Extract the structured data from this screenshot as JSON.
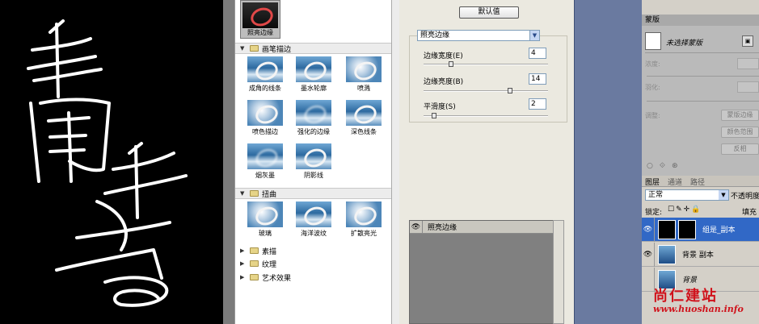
{
  "gallery": {
    "selected": {
      "label": "照亮边缘"
    },
    "categories": [
      {
        "label": "画笔描边",
        "expanded": true
      },
      {
        "label": "扭曲",
        "expanded": true
      },
      {
        "label": "素描",
        "expanded": false
      },
      {
        "label": "纹理",
        "expanded": false
      },
      {
        "label": "艺术效果",
        "expanded": false
      }
    ],
    "brush_filters": [
      "成角的线条",
      "墨水轮廓",
      "喷溅",
      "喷色描边",
      "强化的边缘",
      "深色线条",
      "烟灰墨",
      "阴影线"
    ],
    "distort_filters": [
      "玻璃",
      "海洋波纹",
      "扩散亮光"
    ]
  },
  "settings": {
    "default_button": "默认值",
    "filter_select": "照亮边缘",
    "params": [
      {
        "label": "边缘宽度(E)",
        "value": "4",
        "slider_fraction": 0.21
      },
      {
        "label": "边缘亮度(B)",
        "value": "14",
        "slider_fraction": 0.7
      },
      {
        "label": "平滑度(S)",
        "value": "2",
        "slider_fraction": 0.07
      }
    ],
    "effect_layer": "照亮边缘"
  },
  "mask_panel": {
    "tab": "蒙版",
    "mask_name": "未选择蒙版",
    "density_label": "浓度:",
    "feather_label": "羽化:",
    "adjust_label": "调整:",
    "mask_edge_button": "蒙版边缘",
    "color_range_button": "颜色范围",
    "invert_button": "反相"
  },
  "layers_panel": {
    "tabs": [
      "图层",
      "通道",
      "路径"
    ],
    "blend_mode": "正常",
    "opacity_label": "不透明度",
    "lock_label": "锁定:",
    "fill_label": "填充",
    "layers": [
      {
        "name": "组是_副本",
        "active": true,
        "visible": true
      },
      {
        "name": "背景 副本",
        "active": false,
        "visible": true
      },
      {
        "name": "背景",
        "active": false,
        "visible": false
      }
    ]
  },
  "watermark": {
    "text": "尚仁建站",
    "url": "www.huoshan.info"
  },
  "colors": {
    "accent": "#3168c6",
    "watermark": "#d0121b"
  }
}
